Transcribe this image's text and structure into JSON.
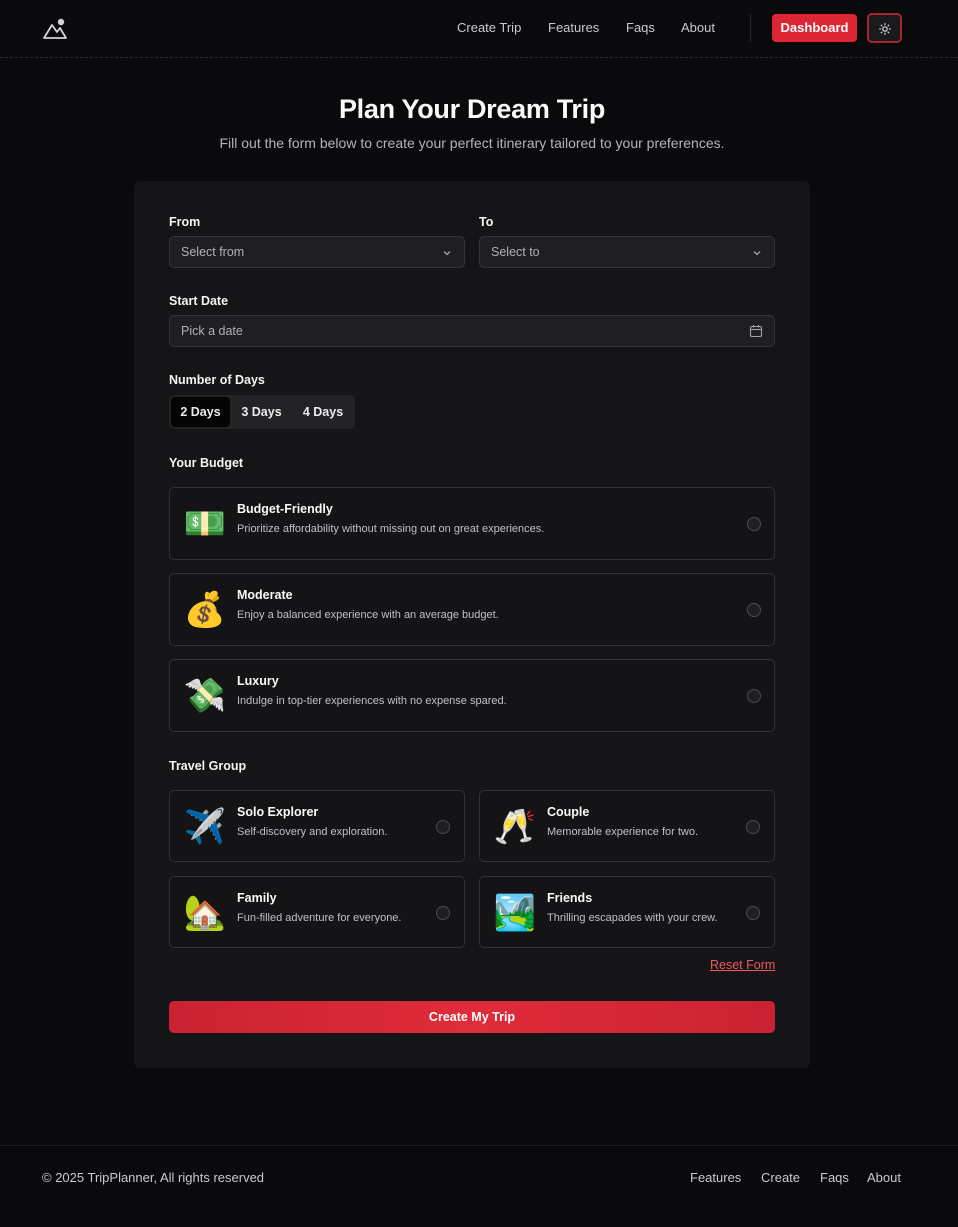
{
  "nav": {
    "links": [
      "Create Trip",
      "Features",
      "Faqs",
      "About"
    ],
    "dashboard_label": "Dashboard"
  },
  "hero": {
    "title": "Plan Your Dream Trip",
    "subtitle": "Fill out the form below to create your perfect itinerary tailored to your preferences."
  },
  "form": {
    "from_label": "From",
    "from_placeholder": "Select from",
    "to_label": "To",
    "to_placeholder": "Select to",
    "date_label": "Start Date",
    "date_placeholder": "Pick a date",
    "days_label": "Number of Days",
    "days": [
      "2 Days",
      "3 Days",
      "4 Days"
    ],
    "days_selected": "2 Days",
    "budget_label": "Your Budget",
    "budget": [
      {
        "title": "Budget-Friendly",
        "desc": "Prioritize affordability without missing out on great experiences.",
        "icon": "💵"
      },
      {
        "title": "Moderate",
        "desc": "Enjoy a balanced experience with an average budget.",
        "icon": "💰"
      },
      {
        "title": "Luxury",
        "desc": "Indulge in top-tier experiences with no expense spared.",
        "icon": "💸"
      }
    ],
    "group_label": "Travel Group",
    "groups": [
      {
        "title": "Solo Explorer",
        "desc": "Self-discovery and exploration.",
        "icon": "✈️"
      },
      {
        "title": "Couple",
        "desc": "Memorable experience for two.",
        "icon": "🥂"
      },
      {
        "title": "Family",
        "desc": "Fun-filled adventure for everyone.",
        "icon": "🏡"
      },
      {
        "title": "Friends",
        "desc": "Thrilling escapades with your crew.",
        "icon": "🏞️"
      }
    ],
    "reset_label": "Reset Form",
    "submit_label": "Create My Trip"
  },
  "footer": {
    "copyright": "© 2025 TripPlanner, All rights reserved",
    "links": [
      "Features",
      "Create",
      "Faqs",
      "About"
    ]
  },
  "colors": {
    "accent": "#dc2634",
    "background": "#0a0a0c",
    "card": "#151517"
  }
}
